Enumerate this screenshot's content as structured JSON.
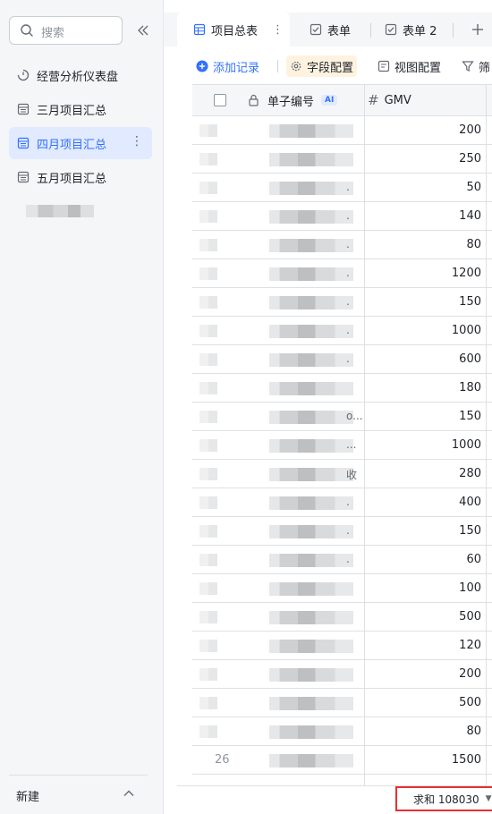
{
  "sidebar": {
    "search_placeholder": "搜索",
    "items": [
      {
        "label": "经营分析仪表盘",
        "icon": "dashboard-icon",
        "active": false
      },
      {
        "label": "三月项目汇总",
        "icon": "table-icon",
        "active": false
      },
      {
        "label": "四月项目汇总",
        "icon": "table-icon",
        "active": true
      },
      {
        "label": "五月项目汇总",
        "icon": "table-icon",
        "active": false
      }
    ],
    "footer_new_label": "新建"
  },
  "tabs": [
    {
      "label": "项目总表",
      "icon": "table-icon",
      "active": true
    },
    {
      "label": "表单",
      "icon": "form-icon",
      "active": false
    },
    {
      "label": "表单 2",
      "icon": "form-icon",
      "active": false
    }
  ],
  "toolbar": {
    "add_record": "添加记录",
    "field_config": "字段配置",
    "view_config": "视图配置",
    "filter": "筛"
  },
  "grid": {
    "columns": {
      "id_header": "单子编号",
      "id_badge": "AI",
      "gmv_header": "GMV"
    },
    "rows": [
      {
        "gmv": "200",
        "tail": ""
      },
      {
        "gmv": "250",
        "tail": ""
      },
      {
        "gmv": "50",
        "tail": "."
      },
      {
        "gmv": "140",
        "tail": "."
      },
      {
        "gmv": "80",
        "tail": "."
      },
      {
        "gmv": "1200",
        "tail": "."
      },
      {
        "gmv": "150",
        "tail": "."
      },
      {
        "gmv": "1000",
        "tail": "."
      },
      {
        "gmv": "600",
        "tail": "."
      },
      {
        "gmv": "180",
        "tail": ""
      },
      {
        "gmv": "150",
        "tail": "o..."
      },
      {
        "gmv": "1000",
        "tail": "..."
      },
      {
        "gmv": "280",
        "tail": "收"
      },
      {
        "gmv": "400",
        "tail": "."
      },
      {
        "gmv": "150",
        "tail": "."
      },
      {
        "gmv": "60",
        "tail": "."
      },
      {
        "gmv": "100",
        "tail": ""
      },
      {
        "gmv": "500",
        "tail": ""
      },
      {
        "gmv": "120",
        "tail": ""
      },
      {
        "gmv": "200",
        "tail": ""
      },
      {
        "gmv": "500",
        "tail": ""
      },
      {
        "gmv": "80",
        "tail": ""
      },
      {
        "gmv": "1500",
        "tail": "",
        "index": "26"
      }
    ],
    "sum_label": "求和 108030"
  }
}
